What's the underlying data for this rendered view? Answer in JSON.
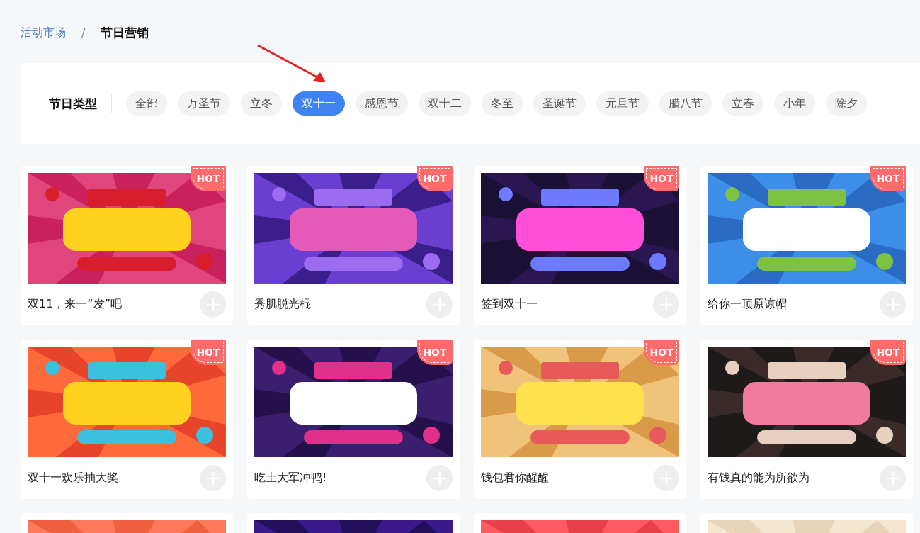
{
  "breadcrumb": {
    "parent": "活动市场",
    "separator": "/",
    "current": "节日营销"
  },
  "filter": {
    "label": "节日类型",
    "options": [
      {
        "label": "全部",
        "selected": false
      },
      {
        "label": "万圣节",
        "selected": false
      },
      {
        "label": "立冬",
        "selected": false
      },
      {
        "label": "双十一",
        "selected": true
      },
      {
        "label": "感恩节",
        "selected": false
      },
      {
        "label": "双十二",
        "selected": false
      },
      {
        "label": "冬至",
        "selected": false
      },
      {
        "label": "圣诞节",
        "selected": false
      },
      {
        "label": "元旦节",
        "selected": false
      },
      {
        "label": "腊八节",
        "selected": false
      },
      {
        "label": "立春",
        "selected": false
      },
      {
        "label": "小年",
        "selected": false
      },
      {
        "label": "除夕",
        "selected": false
      }
    ]
  },
  "cards": [
    {
      "title": "双11，来一“发”吧",
      "hot": true,
      "badge": "HOT"
    },
    {
      "title": "秀肌脱光棍",
      "hot": true,
      "badge": "HOT"
    },
    {
      "title": "签到双十一",
      "hot": true,
      "badge": "HOT"
    },
    {
      "title": "给你一顶原谅帽",
      "hot": true,
      "badge": "HOT"
    },
    {
      "title": "双十一欢乐抽大奖",
      "hot": true,
      "badge": "HOT"
    },
    {
      "title": "吃土大军冲鸭!",
      "hot": true,
      "badge": "HOT"
    },
    {
      "title": "钱包君你醒醒",
      "hot": true,
      "badge": "HOT"
    },
    {
      "title": "有钱真的能为所欲为",
      "hot": true,
      "badge": "HOT"
    },
    {
      "hot": false
    },
    {
      "hot": false
    },
    {
      "hot": false
    },
    {
      "hot": false
    }
  ]
}
